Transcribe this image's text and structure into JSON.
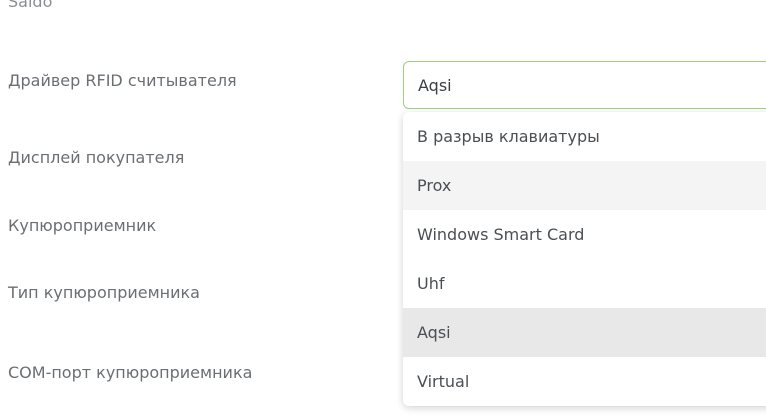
{
  "form": {
    "cut_label": "Saldo",
    "labels": [
      "Драйвер RFID считывателя",
      "Дисплей покупателя",
      "Купюроприемник",
      "Тип купюроприемника",
      "COM-порт купюроприемника"
    ]
  },
  "rfid_select": {
    "value": "Aqsi",
    "options": [
      "В разрыв клавиатуры",
      "Prox",
      "Windows Smart Card",
      "Uhf",
      "Aqsi",
      "Virtual"
    ],
    "selected_option": "Aqsi",
    "hovered_option": "Prox"
  },
  "colors": {
    "focus_border": "#9bd37a",
    "selected_bg": "#e8e8e8",
    "hover_bg": "#f4f4f4"
  }
}
